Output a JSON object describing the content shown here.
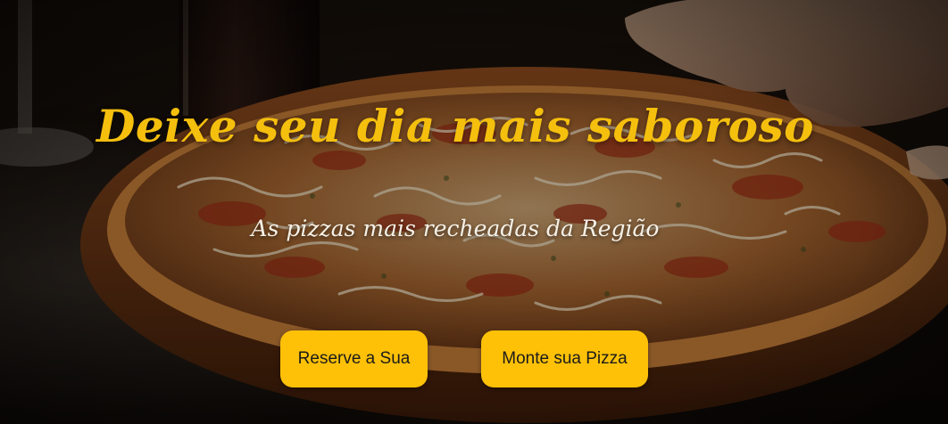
{
  "hero": {
    "headline": "Deixe seu dia mais saboroso",
    "subheadline": "As pizzas mais recheadas da Região",
    "buttons": [
      {
        "label": "Reserve a Sua"
      },
      {
        "label": "Monte sua Pizza"
      }
    ]
  },
  "colors": {
    "headline": "#f5bf0e",
    "subheadline": "#f6f1e7",
    "button_background": "#ffc107",
    "button_text": "#1b1b1b"
  },
  "background_image": {
    "subject": "pizza-photo"
  }
}
